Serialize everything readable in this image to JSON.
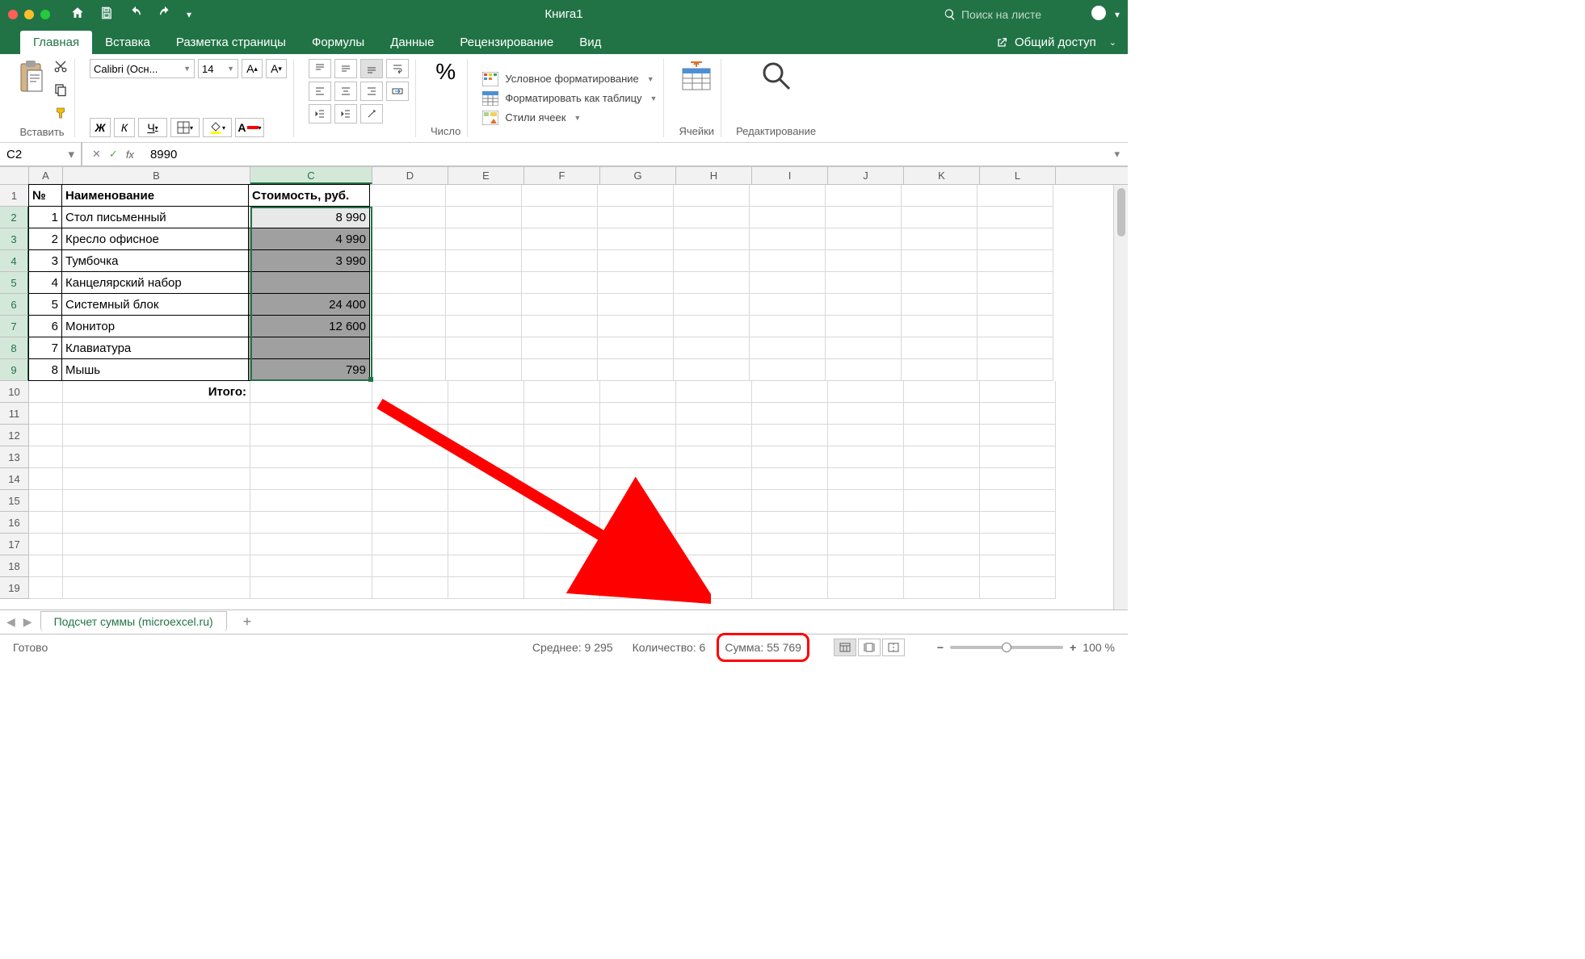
{
  "titlebar": {
    "title": "Книга1",
    "search_placeholder": "Поиск на листе"
  },
  "tabs": {
    "items": [
      "Главная",
      "Вставка",
      "Разметка страницы",
      "Формулы",
      "Данные",
      "Рецензирование",
      "Вид"
    ],
    "share": "Общий доступ"
  },
  "ribbon": {
    "paste": "Вставить",
    "font_name": "Calibri (Осн...",
    "font_size": "14",
    "bold": "Ж",
    "italic": "К",
    "underline": "Ч",
    "number": "Число",
    "cond_format": "Условное форматирование",
    "format_table": "Форматировать как таблицу",
    "cell_styles": "Стили ячеек",
    "cells": "Ячейки",
    "editing": "Редактирование"
  },
  "formula_bar": {
    "cell_ref": "C2",
    "value": "8990"
  },
  "columns": [
    "A",
    "B",
    "C",
    "D",
    "E",
    "F",
    "G",
    "H",
    "I",
    "J",
    "K",
    "L"
  ],
  "table": {
    "headers": {
      "num": "№",
      "name": "Наименование",
      "cost": "Стоимость, руб."
    },
    "rows": [
      {
        "num": "1",
        "name": "Стол письменный",
        "cost": "8 990"
      },
      {
        "num": "2",
        "name": "Кресло офисное",
        "cost": "4 990"
      },
      {
        "num": "3",
        "name": "Тумбочка",
        "cost": "3 990"
      },
      {
        "num": "4",
        "name": "Канцелярский набор",
        "cost": ""
      },
      {
        "num": "5",
        "name": "Системный блок",
        "cost": "24 400"
      },
      {
        "num": "6",
        "name": "Монитор",
        "cost": "12 600"
      },
      {
        "num": "7",
        "name": "Клавиатура",
        "cost": ""
      },
      {
        "num": "8",
        "name": "Мышь",
        "cost": "799"
      }
    ],
    "total_label": "Итого:"
  },
  "sheet": {
    "name": "Подсчет суммы (microexcel.ru)"
  },
  "status": {
    "ready": "Готово",
    "avg": "Среднее: 9 295",
    "count": "Количество: 6",
    "sum": "Сумма: 55 769",
    "zoom": "100 %"
  }
}
